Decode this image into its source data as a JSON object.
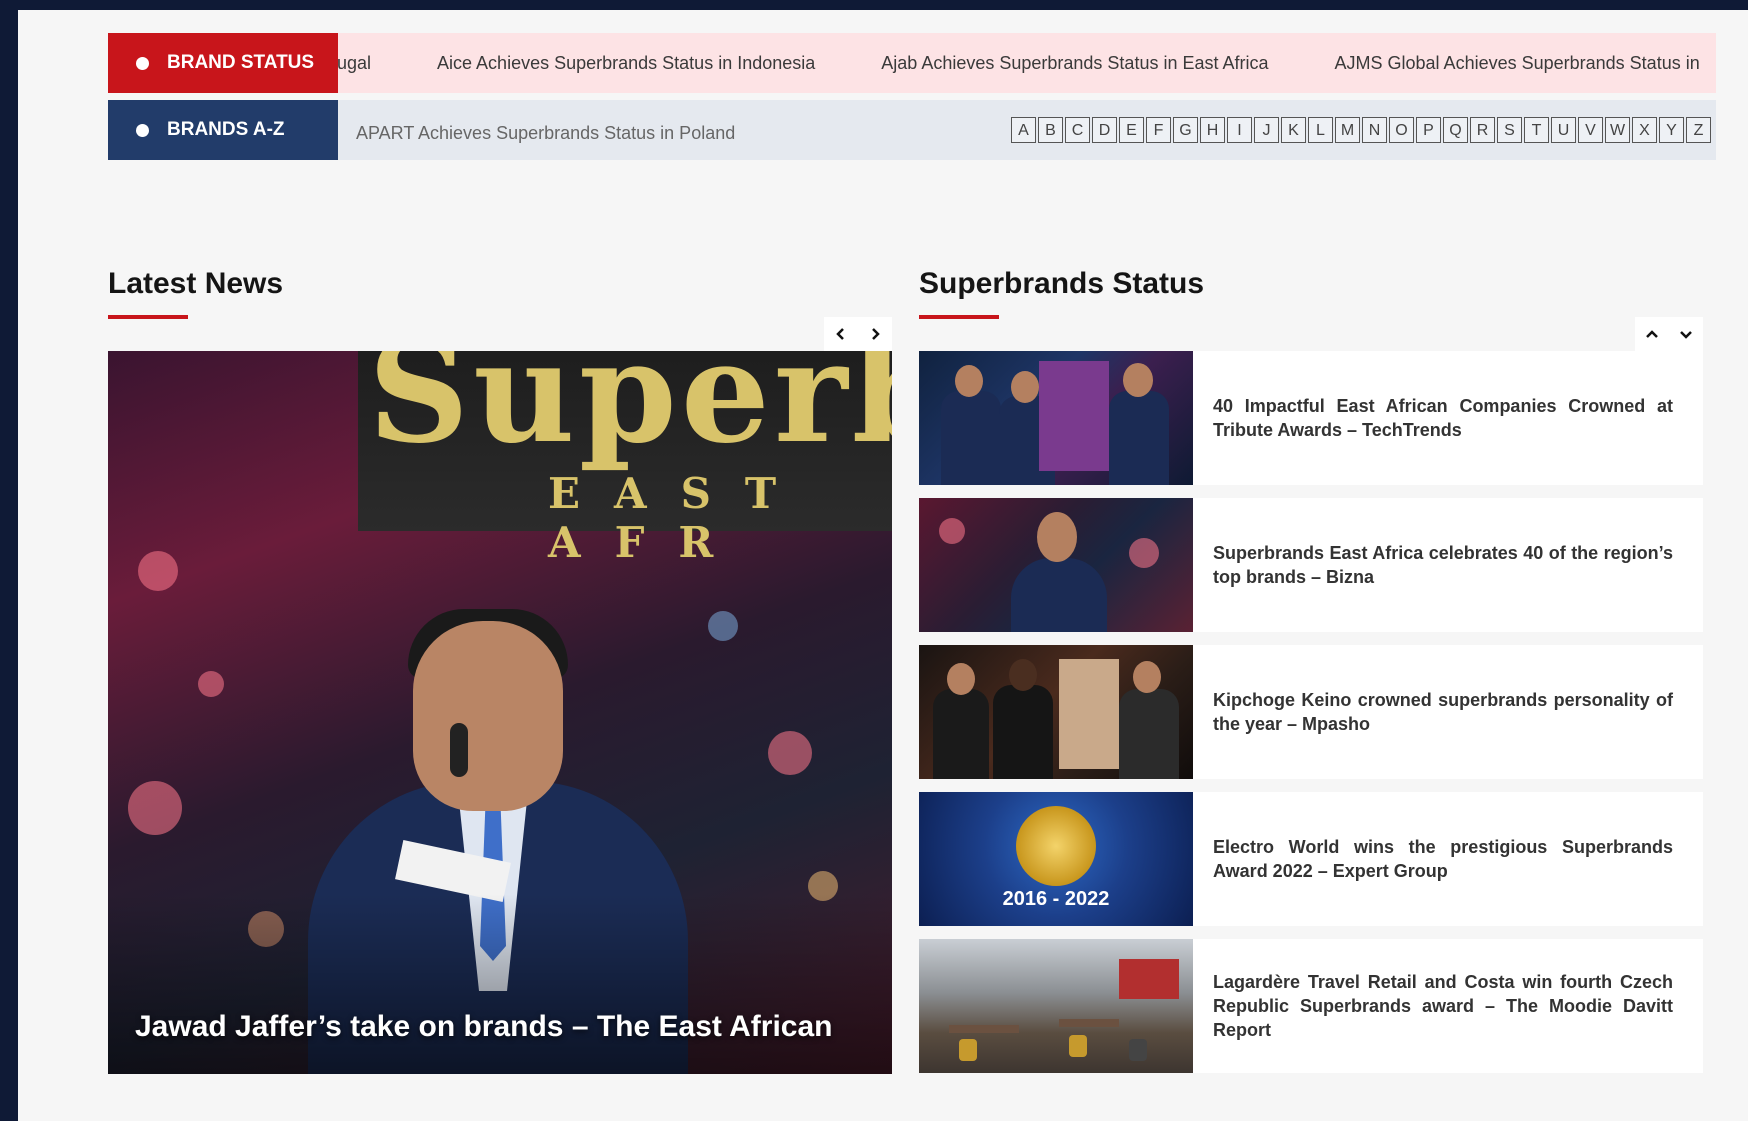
{
  "brand_status": {
    "label": "BRAND STATUS",
    "items": [
      "rtugal",
      "Aice Achieves Superbrands Status in Indonesia",
      "Ajab Achieves Superbrands Status in East Africa",
      "AJMS Global Achieves Superbrands Status in"
    ]
  },
  "brands_az": {
    "label": "BRANDS A-Z",
    "headline": "APART Achieves Superbrands Status in Poland",
    "letters": [
      "A",
      "B",
      "C",
      "D",
      "E",
      "F",
      "G",
      "H",
      "I",
      "J",
      "K",
      "L",
      "M",
      "N",
      "O",
      "P",
      "Q",
      "R",
      "S",
      "T",
      "U",
      "V",
      "W",
      "X",
      "Y",
      "Z"
    ]
  },
  "latest_news": {
    "title": "Latest News",
    "prev_icon": "chevron-left-icon",
    "next_icon": "chevron-right-icon",
    "featured": {
      "caption": "Jawad Jaffer’s take on brands – The East African",
      "sign_text": "Superbrands",
      "sign_sub": "EAST AFR"
    }
  },
  "superbrands_status": {
    "title": "Superbrands Status",
    "up_icon": "chevron-up-icon",
    "down_icon": "chevron-down-icon",
    "items": [
      {
        "title": "40 Impactful East African Companies Crowned at Tribute Awards – TechTrends"
      },
      {
        "title": "Superbrands East Africa celebrates 40 of the region’s top brands – Bizna"
      },
      {
        "title": "Kipchoge Keino crowned superbrands personality of the year – Mpasho"
      },
      {
        "title": "Electro World wins the prestigious Superbrands Award 2022 – Expert Group",
        "thumb_text": "2016 - 2022"
      },
      {
        "title": "Lagardère Travel Retail and Costa win fourth Czech Republic Superbrands award – The Moodie Davitt Report"
      }
    ]
  },
  "colors": {
    "brand_red": "#c8151b",
    "brand_navy": "#223c6a",
    "ticker_pink": "#fde3e5",
    "ticker_gray": "#e5e9ef"
  }
}
